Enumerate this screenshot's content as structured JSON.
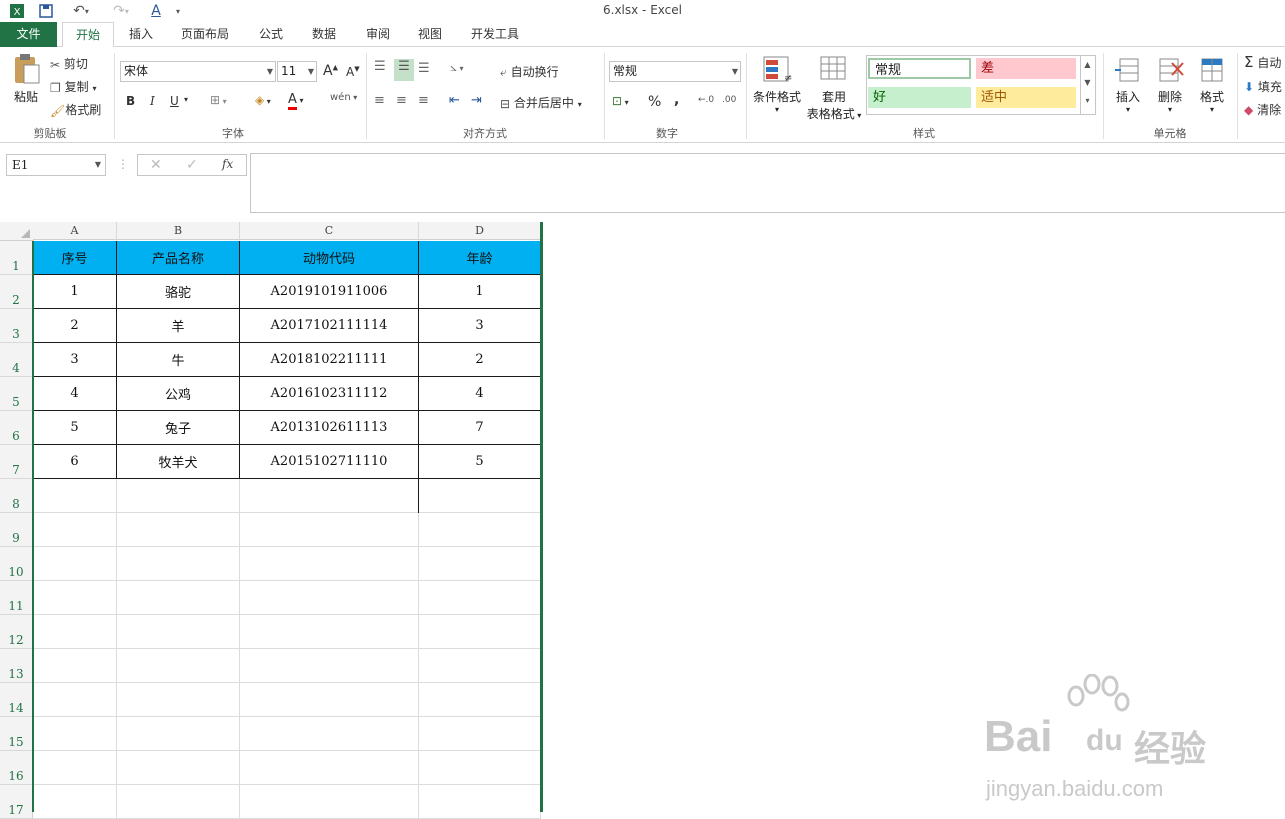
{
  "window": {
    "title": "6.xlsx - Excel"
  },
  "tabs": [
    "文件",
    "开始",
    "插入",
    "页面布局",
    "公式",
    "数据",
    "审阅",
    "视图",
    "开发工具"
  ],
  "clipboard": {
    "paste": "粘贴",
    "cut": "剪切",
    "copy": "复制",
    "format_painter": "格式刷",
    "label": "剪贴板"
  },
  "font": {
    "name": "宋体",
    "size": "11",
    "bold": "B",
    "italic": "I",
    "underline": "U",
    "label": "字体",
    "grow": "A",
    "shrink": "A",
    "font_color": "A"
  },
  "alignment": {
    "wrap": "自动换行",
    "merge": "合并后居中",
    "label": "对齐方式"
  },
  "number": {
    "format": "常规",
    "percent": "%",
    "comma": ",",
    "label": "数字"
  },
  "styles": {
    "conditional": "条件格式",
    "table1": "套用",
    "table2": "表格格式",
    "normal": "常规",
    "bad": "差",
    "good": "好",
    "neutral": "适中",
    "label": "样式"
  },
  "cells": {
    "insert": "插入",
    "delete": "删除",
    "format": "格式",
    "label": "单元格"
  },
  "editing": {
    "autosum": "自动",
    "fill": "填充",
    "clear": "清除"
  },
  "formula_bar": {
    "name_box": "E1",
    "fx": "fx",
    "formula": ""
  },
  "columns": [
    "A",
    "B",
    "C",
    "D"
  ],
  "rows": [
    "1",
    "2",
    "3",
    "4",
    "5",
    "6",
    "7",
    "8",
    "9",
    "10",
    "11",
    "12",
    "13",
    "14",
    "15",
    "16",
    "17"
  ],
  "table": {
    "header": [
      "序号",
      "产品名称",
      "动物代码",
      "年龄"
    ],
    "rows": [
      [
        "1",
        "骆驼",
        "A2019101911006",
        "1"
      ],
      [
        "2",
        "羊",
        "A2017102111114",
        "3"
      ],
      [
        "3",
        "牛",
        "A2018102211111",
        "2"
      ],
      [
        "4",
        "公鸡",
        "A2016102311112",
        "4"
      ],
      [
        "5",
        "兔子",
        "A2013102611113",
        "7"
      ],
      [
        "6",
        "牧羊犬",
        "A2015102711110",
        "5"
      ]
    ]
  },
  "watermark": {
    "brand": "Bai",
    "brand2": "du",
    "cn": "经验",
    "url": "jingyan.baidu.com"
  },
  "colors": {
    "excel_green": "#217346",
    "header_fill": "#00b0f0",
    "bad_fill": "#ffc7ce",
    "good_fill": "#c6efce",
    "neutral_fill": "#ffeb9c"
  }
}
